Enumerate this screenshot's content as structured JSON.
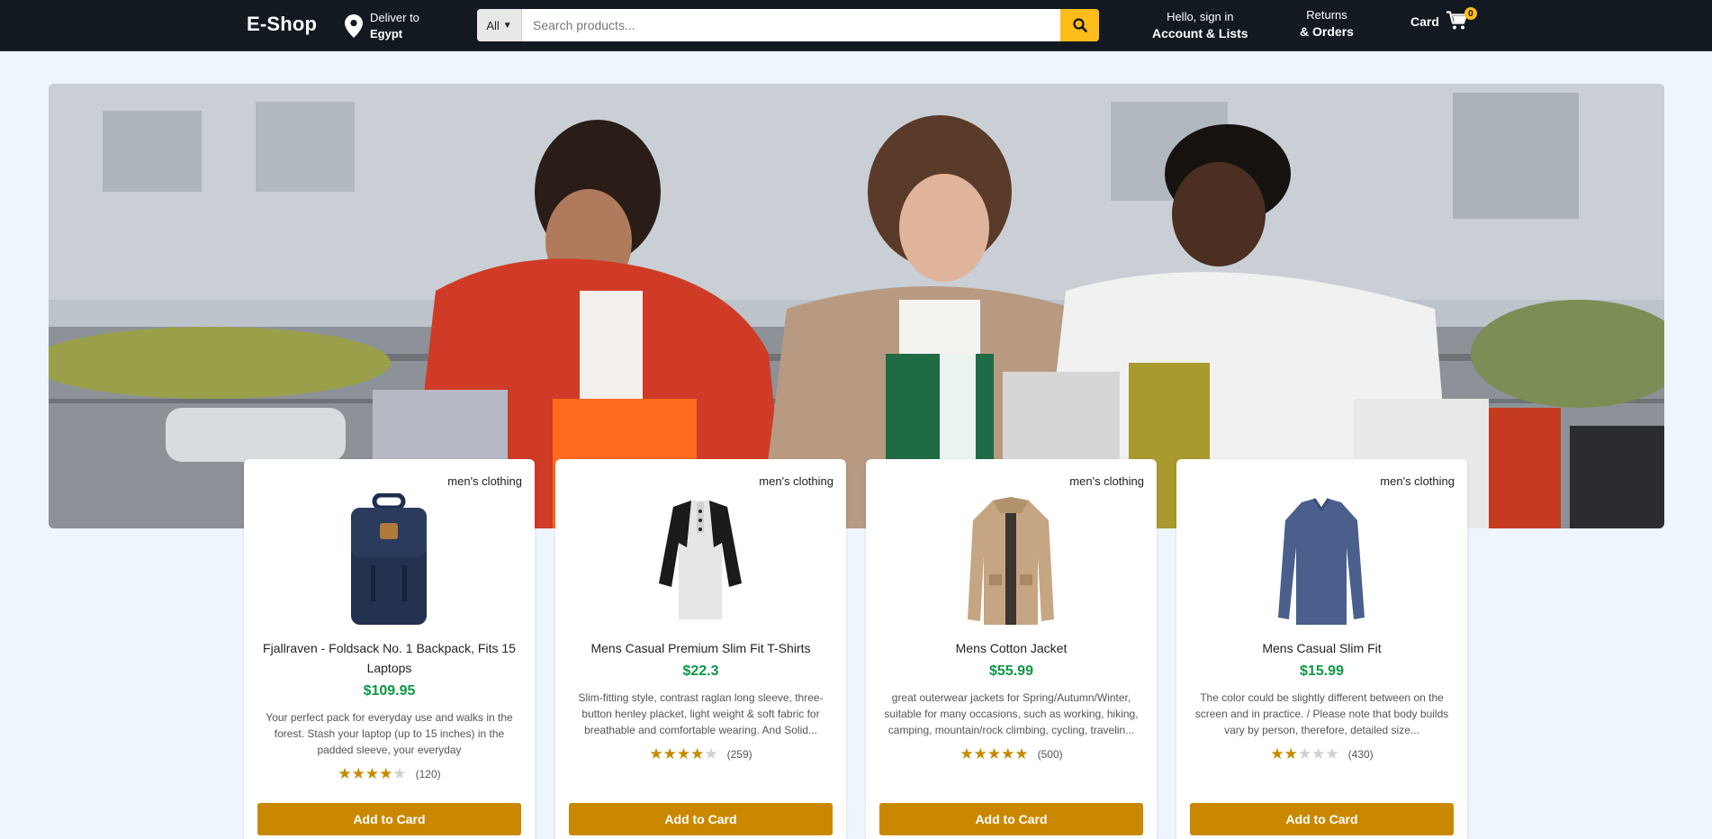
{
  "nav": {
    "logo": "E-Shop",
    "deliver_line1": "Deliver to",
    "deliver_line2": "Egypt",
    "search_category": "All",
    "search_placeholder": "Search products...",
    "account_line1": "Hello, sign in",
    "account_line2": "Account & Lists",
    "returns_line1": "Returns",
    "returns_line2": "& Orders",
    "cart_label": "Card",
    "cart_count": "0"
  },
  "colors": {
    "navbar": "#131921",
    "accent": "#febd1a",
    "button": "#c98800",
    "price": "#0d9744",
    "page_bg": "#eef5fd"
  },
  "products": [
    {
      "category": "men's clothing",
      "title": "Fjallraven - Foldsack No. 1 Backpack, Fits 15 Laptops",
      "price": "$109.95",
      "description": "Your perfect pack for everyday use and walks in the forest. Stash your laptop (up to 15 inches) in the padded sleeve, your everyday",
      "stars": 4,
      "count": "(120)",
      "button": "Add to Card",
      "image": "backpack"
    },
    {
      "category": "men's clothing",
      "title": "Mens Casual Premium Slim Fit T-Shirts",
      "price": "$22.3",
      "description": "Slim-fitting style, contrast raglan long sleeve, three-button henley placket, light weight & soft fabric for breathable and comfortable wearing. And Solid...",
      "stars": 4,
      "count": "(259)",
      "button": "Add to Card",
      "image": "henley-shirt"
    },
    {
      "category": "men's clothing",
      "title": "Mens Cotton Jacket",
      "price": "$55.99",
      "description": "great outerwear jackets for Spring/Autumn/Winter, suitable for many occasions, such as working, hiking, camping, mountain/rock climbing, cycling, travelin...",
      "stars": 5,
      "count": "(500)",
      "button": "Add to Card",
      "image": "jacket"
    },
    {
      "category": "men's clothing",
      "title": "Mens Casual Slim Fit",
      "price": "$15.99",
      "description": "The color could be slightly different between on the screen and in practice. / Please note that body builds vary by person, therefore, detailed size...",
      "stars": 2,
      "count": "(430)",
      "button": "Add to Card",
      "image": "long-sleeve-shirt"
    }
  ]
}
